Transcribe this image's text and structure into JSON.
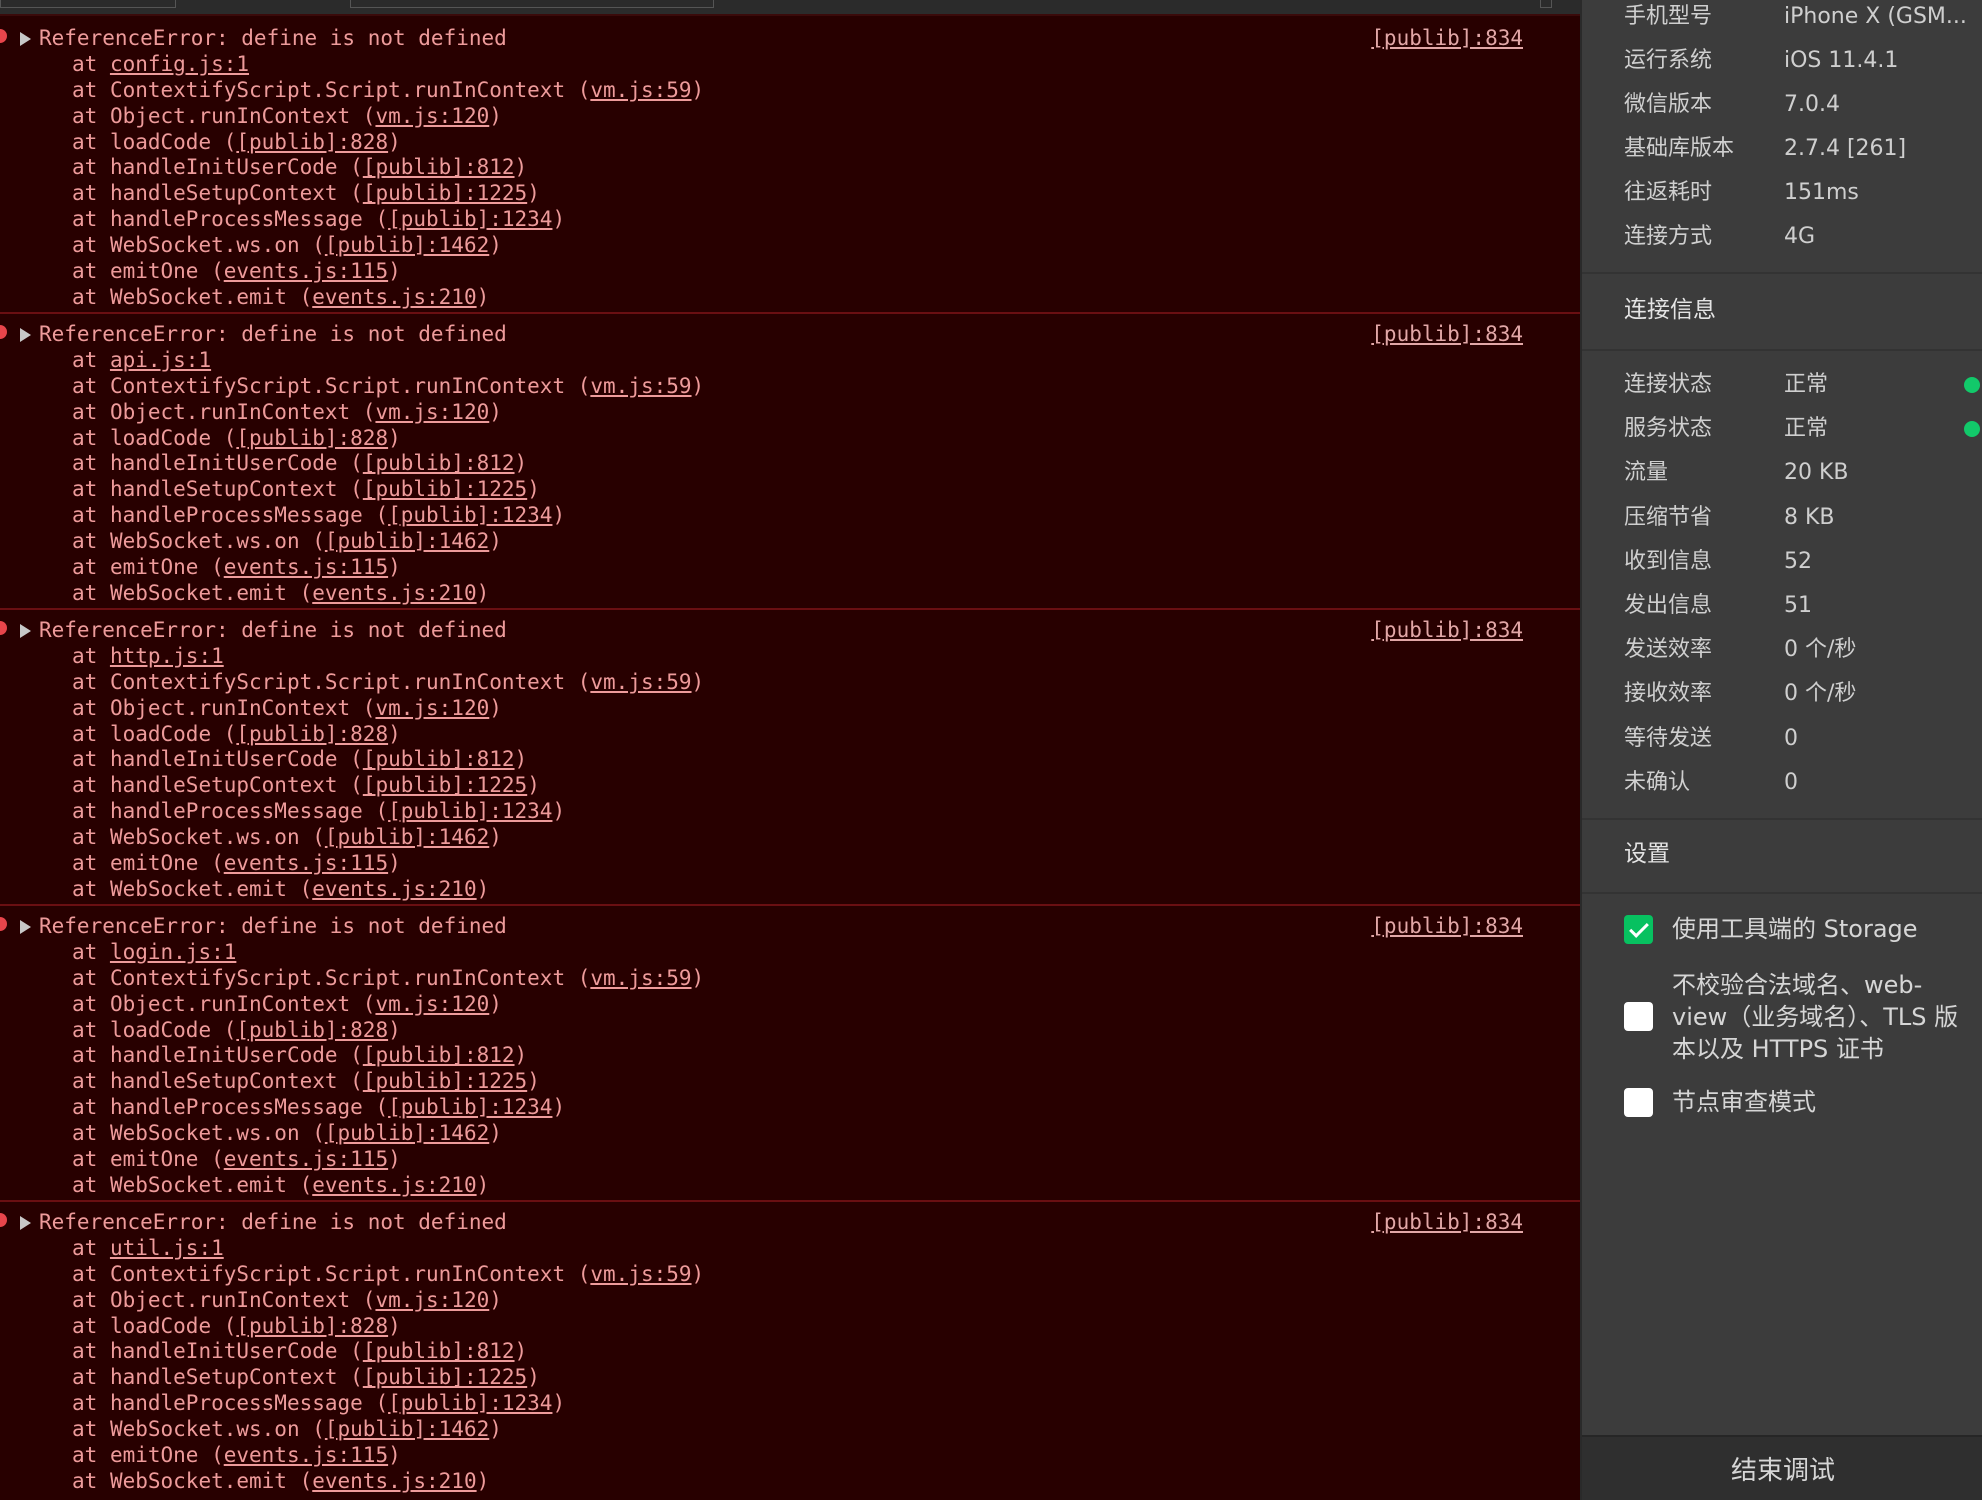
{
  "console": {
    "messages": [
      {
        "text": "ReferenceError: define is not defined",
        "source": "[publib]:834",
        "frames": [
          {
            "pre": "at ",
            "fn": "",
            "link": "config.js:1"
          },
          {
            "pre": "at ",
            "fn": "ContextifyScript.Script.runInContext (",
            "link": "vm.js:59"
          },
          {
            "pre": "at ",
            "fn": "Object.runInContext (",
            "link": "vm.js:120"
          },
          {
            "pre": "at ",
            "fn": "loadCode (",
            "link": "[publib]:828"
          },
          {
            "pre": "at ",
            "fn": "handleInitUserCode (",
            "link": "[publib]:812"
          },
          {
            "pre": "at ",
            "fn": "handleSetupContext (",
            "link": "[publib]:1225"
          },
          {
            "pre": "at ",
            "fn": "handleProcessMessage (",
            "link": "[publib]:1234"
          },
          {
            "pre": "at ",
            "fn": "WebSocket.ws.on (",
            "link": "[publib]:1462"
          },
          {
            "pre": "at ",
            "fn": "emitOne (",
            "link": "events.js:115"
          },
          {
            "pre": "at ",
            "fn": "WebSocket.emit (",
            "link": "events.js:210"
          }
        ]
      },
      {
        "text": "ReferenceError: define is not defined",
        "source": "[publib]:834",
        "frames": [
          {
            "pre": "at ",
            "fn": "",
            "link": "api.js:1"
          },
          {
            "pre": "at ",
            "fn": "ContextifyScript.Script.runInContext (",
            "link": "vm.js:59"
          },
          {
            "pre": "at ",
            "fn": "Object.runInContext (",
            "link": "vm.js:120"
          },
          {
            "pre": "at ",
            "fn": "loadCode (",
            "link": "[publib]:828"
          },
          {
            "pre": "at ",
            "fn": "handleInitUserCode (",
            "link": "[publib]:812"
          },
          {
            "pre": "at ",
            "fn": "handleSetupContext (",
            "link": "[publib]:1225"
          },
          {
            "pre": "at ",
            "fn": "handleProcessMessage (",
            "link": "[publib]:1234"
          },
          {
            "pre": "at ",
            "fn": "WebSocket.ws.on (",
            "link": "[publib]:1462"
          },
          {
            "pre": "at ",
            "fn": "emitOne (",
            "link": "events.js:115"
          },
          {
            "pre": "at ",
            "fn": "WebSocket.emit (",
            "link": "events.js:210"
          }
        ]
      },
      {
        "text": "ReferenceError: define is not defined",
        "source": "[publib]:834",
        "frames": [
          {
            "pre": "at ",
            "fn": "",
            "link": "http.js:1"
          },
          {
            "pre": "at ",
            "fn": "ContextifyScript.Script.runInContext (",
            "link": "vm.js:59"
          },
          {
            "pre": "at ",
            "fn": "Object.runInContext (",
            "link": "vm.js:120"
          },
          {
            "pre": "at ",
            "fn": "loadCode (",
            "link": "[publib]:828"
          },
          {
            "pre": "at ",
            "fn": "handleInitUserCode (",
            "link": "[publib]:812"
          },
          {
            "pre": "at ",
            "fn": "handleSetupContext (",
            "link": "[publib]:1225"
          },
          {
            "pre": "at ",
            "fn": "handleProcessMessage (",
            "link": "[publib]:1234"
          },
          {
            "pre": "at ",
            "fn": "WebSocket.ws.on (",
            "link": "[publib]:1462"
          },
          {
            "pre": "at ",
            "fn": "emitOne (",
            "link": "events.js:115"
          },
          {
            "pre": "at ",
            "fn": "WebSocket.emit (",
            "link": "events.js:210"
          }
        ]
      },
      {
        "text": "ReferenceError: define is not defined",
        "source": "[publib]:834",
        "frames": [
          {
            "pre": "at ",
            "fn": "",
            "link": "login.js:1"
          },
          {
            "pre": "at ",
            "fn": "ContextifyScript.Script.runInContext (",
            "link": "vm.js:59"
          },
          {
            "pre": "at ",
            "fn": "Object.runInContext (",
            "link": "vm.js:120"
          },
          {
            "pre": "at ",
            "fn": "loadCode (",
            "link": "[publib]:828"
          },
          {
            "pre": "at ",
            "fn": "handleInitUserCode (",
            "link": "[publib]:812"
          },
          {
            "pre": "at ",
            "fn": "handleSetupContext (",
            "link": "[publib]:1225"
          },
          {
            "pre": "at ",
            "fn": "handleProcessMessage (",
            "link": "[publib]:1234"
          },
          {
            "pre": "at ",
            "fn": "WebSocket.ws.on (",
            "link": "[publib]:1462"
          },
          {
            "pre": "at ",
            "fn": "emitOne (",
            "link": "events.js:115"
          },
          {
            "pre": "at ",
            "fn": "WebSocket.emit (",
            "link": "events.js:210"
          }
        ]
      },
      {
        "text": "ReferenceError: define is not defined",
        "source": "[publib]:834",
        "frames": [
          {
            "pre": "at ",
            "fn": "",
            "link": "util.js:1"
          },
          {
            "pre": "at ",
            "fn": "ContextifyScript.Script.runInContext (",
            "link": "vm.js:59"
          },
          {
            "pre": "at ",
            "fn": "Object.runInContext (",
            "link": "vm.js:120"
          },
          {
            "pre": "at ",
            "fn": "loadCode (",
            "link": "[publib]:828"
          },
          {
            "pre": "at ",
            "fn": "handleInitUserCode (",
            "link": "[publib]:812"
          },
          {
            "pre": "at ",
            "fn": "handleSetupContext (",
            "link": "[publib]:1225"
          },
          {
            "pre": "at ",
            "fn": "handleProcessMessage (",
            "link": "[publib]:1234"
          },
          {
            "pre": "at ",
            "fn": "WebSocket.ws.on (",
            "link": "[publib]:1462"
          },
          {
            "pre": "at ",
            "fn": "emitOne (",
            "link": "events.js:115"
          },
          {
            "pre": "at ",
            "fn": "WebSocket.emit (",
            "link": "events.js:210"
          }
        ]
      }
    ]
  },
  "device_info": [
    {
      "key": "手机型号",
      "value": "iPhone X (GSM..."
    },
    {
      "key": "运行系统",
      "value": "iOS 11.4.1"
    },
    {
      "key": "微信版本",
      "value": "7.0.4"
    },
    {
      "key": "基础库版本",
      "value": "2.7.4 [261]"
    },
    {
      "key": "往返耗时",
      "value": "151ms"
    },
    {
      "key": "连接方式",
      "value": "4G"
    }
  ],
  "connection": {
    "title": "连接信息",
    "rows": [
      {
        "key": "连接状态",
        "value": "正常",
        "status_color": "#12c96a"
      },
      {
        "key": "服务状态",
        "value": "正常",
        "status_color": "#12c96a"
      },
      {
        "key": "流量",
        "value": "20 KB"
      },
      {
        "key": "压缩节省",
        "value": "8 KB"
      },
      {
        "key": "收到信息",
        "value": "52"
      },
      {
        "key": "发出信息",
        "value": "51"
      },
      {
        "key": "发送效率",
        "value": "0 个/秒"
      },
      {
        "key": "接收效率",
        "value": "0 个/秒"
      },
      {
        "key": "等待发送",
        "value": "0"
      },
      {
        "key": "未确认",
        "value": "0"
      }
    ]
  },
  "settings": {
    "title": "设置",
    "options": [
      {
        "label": "使用工具端的 Storage",
        "checked": true
      },
      {
        "label": "不校验合法域名、web-view（业务域名）、TLS 版本以及 HTTPS 证书",
        "checked": false
      },
      {
        "label": "节点审查模式",
        "checked": false
      }
    ]
  },
  "end_debug_label": "结束调试",
  "colors": {
    "console_bg": "#280000",
    "error_text": "#ee9b9b",
    "error_dot": "#e8454b",
    "panel_bg": "#3c3c3c",
    "status_ok": "#12c96a",
    "checkbox_checked": "#07c160"
  }
}
